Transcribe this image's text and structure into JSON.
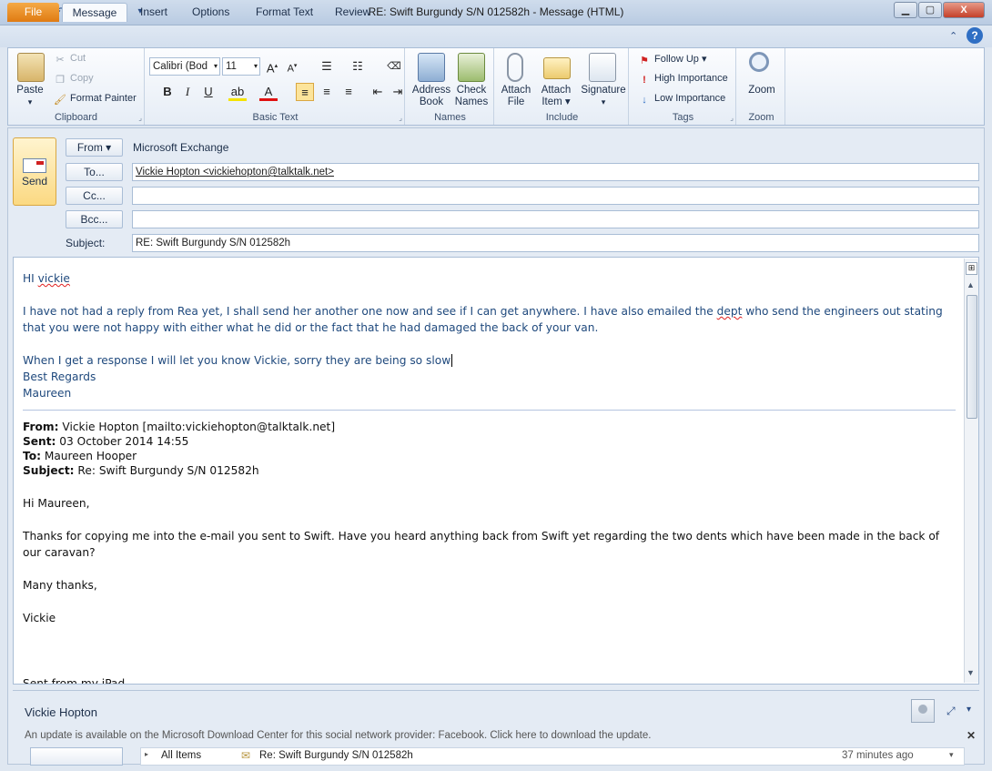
{
  "window": {
    "title": "RE: Swift Burgundy S/N  012582h  -  Message (HTML)",
    "min_label": "▭",
    "max_label": "▢",
    "close_label": "X"
  },
  "tabs": [
    "File",
    "Message",
    "Insert",
    "Options",
    "Format Text",
    "Review"
  ],
  "ribbon": {
    "clipboard": {
      "label": "Clipboard",
      "paste": "Paste",
      "cut": "Cut",
      "copy": "Copy",
      "format_painter": "Format Painter"
    },
    "basic_text": {
      "label": "Basic Text",
      "font": "Calibri (Bod",
      "size": "11"
    },
    "names": {
      "label": "Names",
      "address_book_1": "Address",
      "address_book_2": "Book",
      "check_names_1": "Check",
      "check_names_2": "Names"
    },
    "include": {
      "label": "Include",
      "attach_file_1": "Attach",
      "attach_file_2": "File",
      "attach_item_1": "Attach",
      "attach_item_2": "Item ▾",
      "signature": "Signature"
    },
    "tags": {
      "label": "Tags",
      "follow_up": "Follow Up ▾",
      "high": "High Importance",
      "low": "Low Importance"
    },
    "zoom": {
      "label": "Zoom",
      "zoom": "Zoom"
    }
  },
  "header": {
    "send": "Send",
    "from_btn": "From ▾",
    "from_value": "Microsoft Exchange",
    "to_btn": "To...",
    "to_value": "Vickie Hopton <vickiehopton@talktalk.net>",
    "cc_btn": "Cc...",
    "cc_value": "",
    "bcc_btn": "Bcc...",
    "bcc_value": "",
    "subject_label": "Subject:",
    "subject_value": "RE: Swift Burgundy S/N  012582h"
  },
  "body": {
    "greeting_pre": "HI ",
    "greeting_name": "vickie",
    "para1_a": "I have not had a reply from Rea yet, I shall send her another one now and see if I can get anywhere.  I have also emailed the ",
    "para1_dept": "dept",
    "para1_b": " who send the engineers out stating that you were not happy with either what he did or the fact that he had damaged the back of your van.",
    "para2": "When I get a response I will let you know Vickie, sorry they are being so slow",
    "regards": "Best Regards",
    "signature": "Maureen",
    "quoted": {
      "from_label": "From:",
      "from_value": " Vickie Hopton [mailto:vickiehopton@talktalk.net]",
      "sent_label": "Sent:",
      "sent_value": " 03 October 2014 14:55",
      "to_label": "To:",
      "to_value": " Maureen Hooper",
      "subject_label": "Subject:",
      "subject_value": " Re: Swift Burgundy S/N 012582h",
      "greeting": "Hi Maureen,",
      "para": "Thanks for copying me into the e-mail you sent to Swift.  Have you heard anything back from Swift yet regarding the two dents which have been made in the back of our caravan?",
      "closing": "Many thanks,",
      "name": "Vickie",
      "footer_partial": "Sent from my iPad"
    }
  },
  "people_pane": {
    "name": "Vickie Hopton",
    "update_notice": "An update is available on the Microsoft Download Center for this social network provider: Facebook. Click here to download the update.",
    "filter": "All Items",
    "item_subject": "Re: Swift Burgundy S/N 012582h",
    "item_time": "37 minutes ago"
  }
}
